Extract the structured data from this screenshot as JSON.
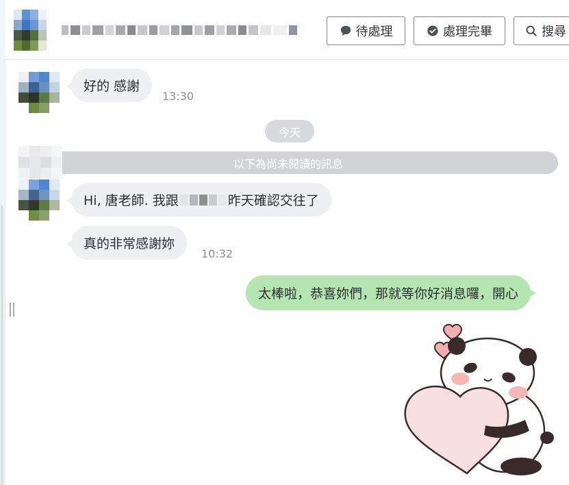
{
  "header": {
    "buttons": {
      "pending": "待處理",
      "done": "處理完畢",
      "search": "搜尋"
    }
  },
  "messages": [
    {
      "text": "好的 感謝",
      "time": "13:30"
    },
    {
      "text_before": "Hi, 唐老師. 我跟",
      "text_after": "昨天確認交往了"
    },
    {
      "text": "真的非常感謝妳",
      "time": "10:32"
    }
  ],
  "separators": {
    "date": "今天",
    "unread": "以下為尚未閱讀的訊息"
  },
  "outgoing": [
    {
      "text": "太棒啦，恭喜妳們，那就等你好消息囉，開心"
    }
  ],
  "colors": {
    "incoming_bubble": "#eef0f2",
    "outgoing_bubble": "#b5e5b1",
    "separator": "#d1d3d6",
    "button_border": "#7f868d"
  },
  "icons": {
    "pending": "speech-bubble-icon",
    "done": "check-circle-icon",
    "search": "magnifier-icon",
    "sticker": "panda-holding-heart-sticker"
  }
}
